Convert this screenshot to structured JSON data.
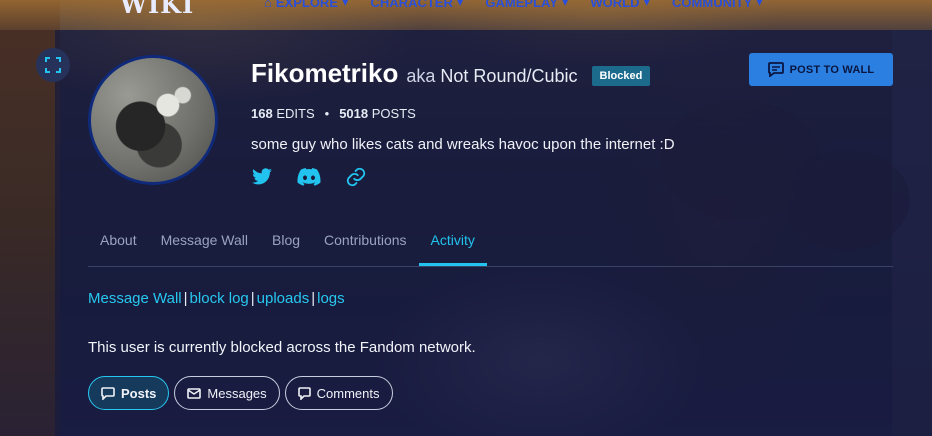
{
  "header": {
    "logo_text": "WIKI",
    "nav": [
      {
        "label": "EXPLORE",
        "icon": "home-icon"
      },
      {
        "label": "CHARACTER"
      },
      {
        "label": "GAMEPLAY"
      },
      {
        "label": "WORLD"
      },
      {
        "label": "COMMUNITY"
      }
    ]
  },
  "profile": {
    "username": "Fikometriko",
    "aka_prefix": "aka",
    "aka_name": "Not Round/Cubic",
    "status_badge": "Blocked",
    "edits_count": "168",
    "edits_label": "EDITS",
    "stats_separator": "•",
    "posts_count": "5018",
    "posts_label": "POSTS",
    "bio": "some guy who likes cats and wreaks havoc upon the internet :D",
    "socials": [
      "twitter-icon",
      "discord-icon",
      "link-icon"
    ]
  },
  "post_button": {
    "label": "POST TO WALL",
    "icon": "message-icon"
  },
  "tabs": [
    {
      "label": "About"
    },
    {
      "label": "Message Wall"
    },
    {
      "label": "Blog"
    },
    {
      "label": "Contributions"
    },
    {
      "label": "Activity",
      "active": true
    }
  ],
  "links": {
    "items": [
      "Message Wall",
      "block log",
      "uploads",
      "logs"
    ],
    "separator": "|"
  },
  "blocked_message": "This user is currently blocked across the Fandom network.",
  "filters": [
    {
      "label": "Posts",
      "active": true,
      "icon": "speech-bubble-icon"
    },
    {
      "label": "Messages",
      "icon": "envelope-icon"
    },
    {
      "label": "Comments",
      "icon": "comment-icon"
    }
  ],
  "colors": {
    "accent": "#22c3ee",
    "button": "#2a7fe0",
    "badge": "#1d6b8c"
  }
}
